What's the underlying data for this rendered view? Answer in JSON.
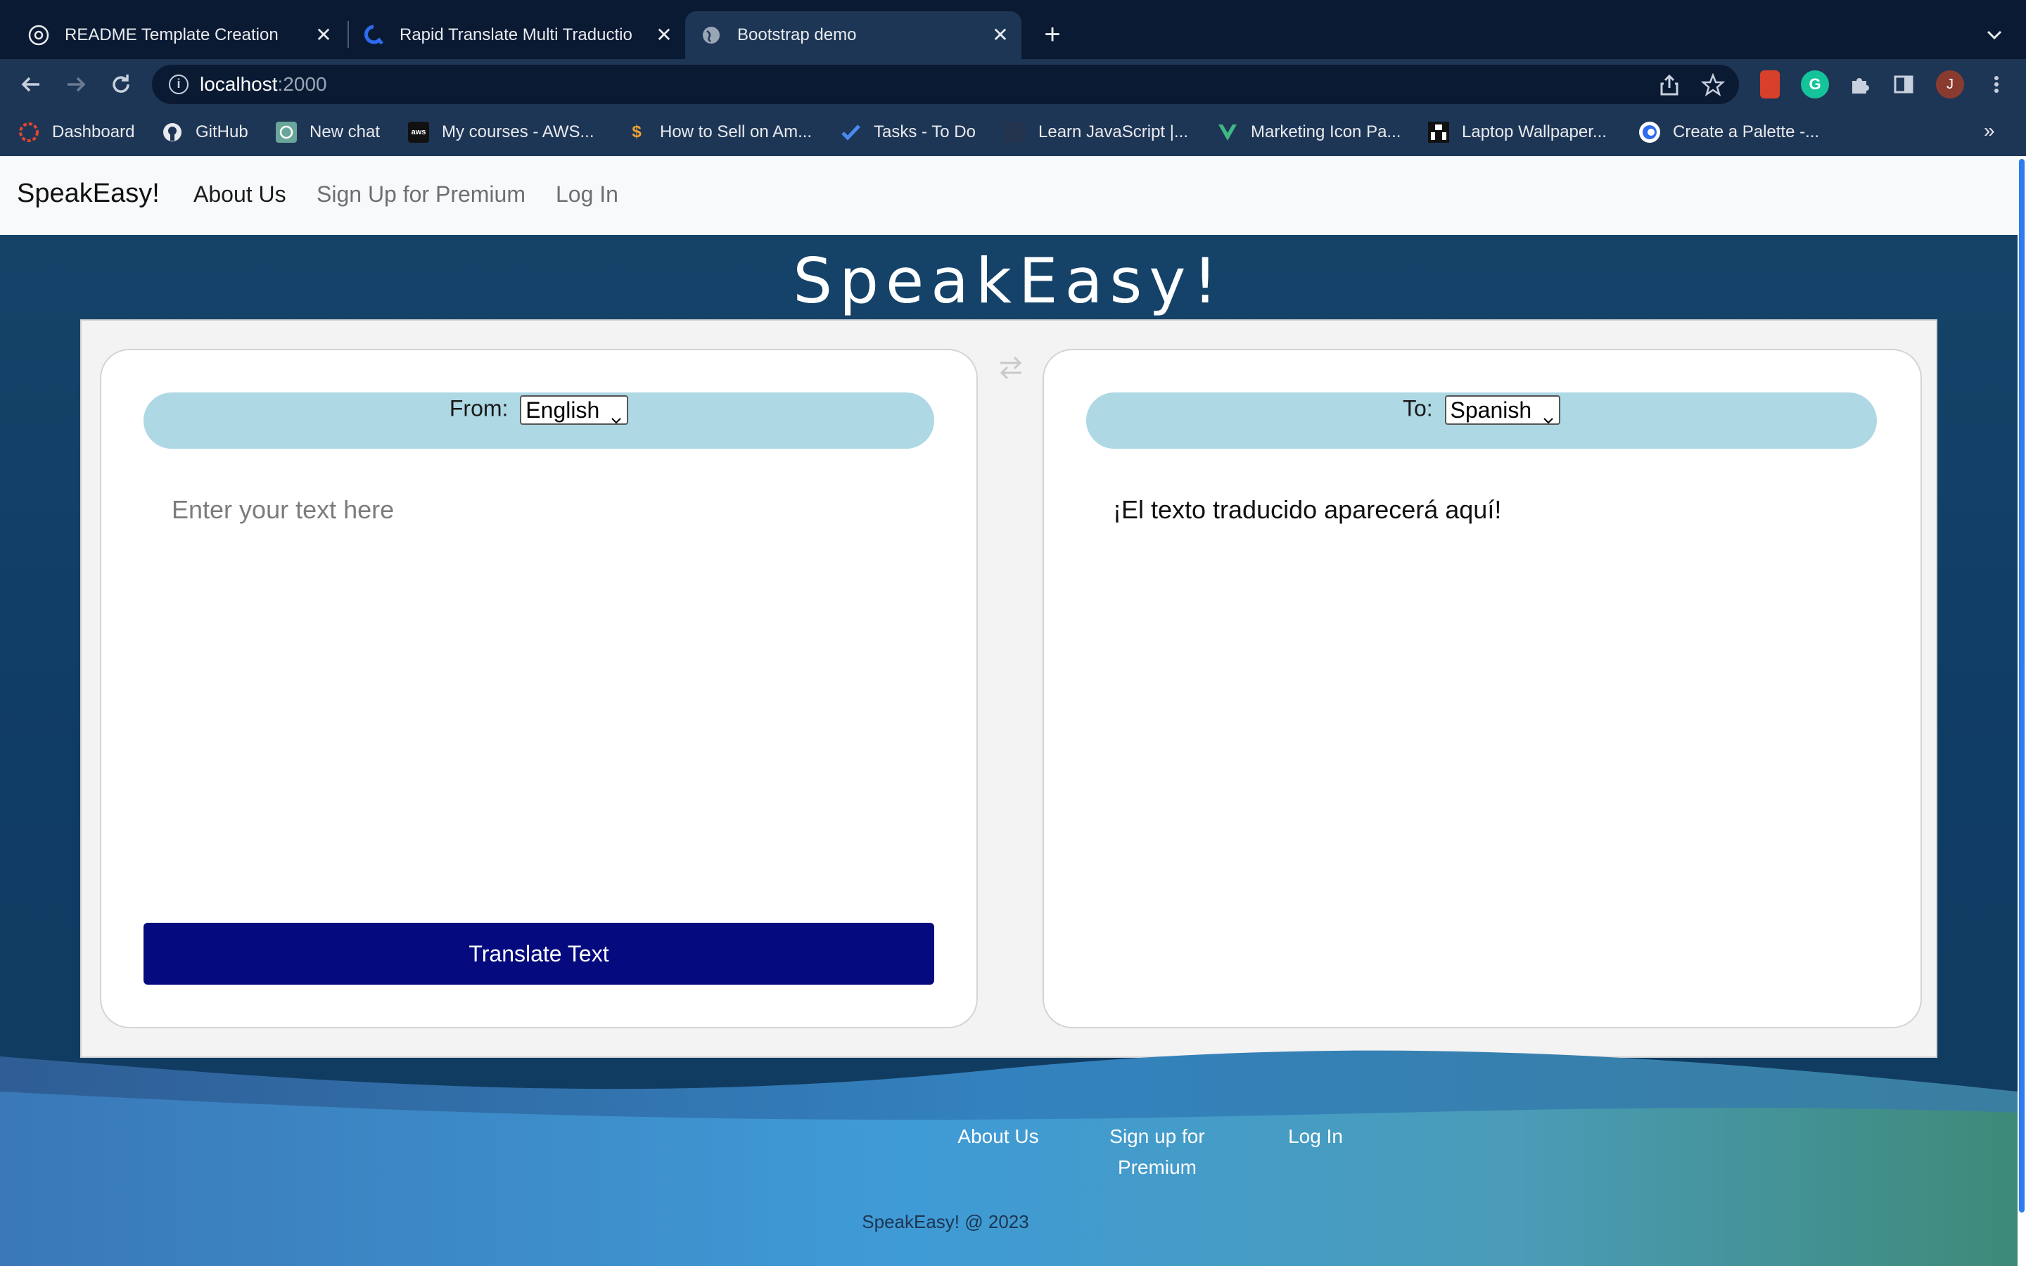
{
  "browser": {
    "tabs": [
      {
        "title": "README Template Creation",
        "favicon": "chatgpt-icon"
      },
      {
        "title": "Rapid Translate Multi Traductio",
        "favicon": "rapid-icon"
      },
      {
        "title": "Bootstrap demo",
        "favicon": "globe-icon",
        "active": true
      }
    ],
    "url": {
      "host": "localhost",
      "port": ":2000"
    },
    "avatar_letter": "J",
    "bookmarks": [
      {
        "label": "Dashboard",
        "icon": "dashboard-icon"
      },
      {
        "label": "GitHub",
        "icon": "github-icon"
      },
      {
        "label": "New chat",
        "icon": "chatgpt-icon"
      },
      {
        "label": "My courses - AWS...",
        "icon": "aws-icon"
      },
      {
        "label": "How to Sell on Am...",
        "icon": "dollar-icon"
      },
      {
        "label": "Tasks - To Do",
        "icon": "todo-icon"
      },
      {
        "label": "Learn JavaScript |...",
        "icon": "js-icon"
      },
      {
        "label": "Marketing Icon Pa...",
        "icon": "vue-icon"
      },
      {
        "label": "Laptop Wallpaper...",
        "icon": "unsplash-icon"
      },
      {
        "label": "Create a Palette -...",
        "icon": "coolors-icon"
      }
    ]
  },
  "nav": {
    "brand": "SpeakEasy!",
    "links": [
      "About Us",
      "Sign Up for Premium",
      "Log In"
    ]
  },
  "hero": {
    "title": "SpeakEasy!"
  },
  "translator": {
    "from_label": "From:",
    "from_value": "English",
    "to_label": "To:",
    "to_value": "Spanish",
    "input_placeholder": "Enter your text here",
    "output_text": "¡El texto traducido aparecerá aquí!",
    "button_label": "Translate Text"
  },
  "footer": {
    "links": [
      "About Us",
      "Sign up for",
      "Premium",
      "Log In"
    ],
    "copyright": "SpeakEasy! @ 2023"
  }
}
